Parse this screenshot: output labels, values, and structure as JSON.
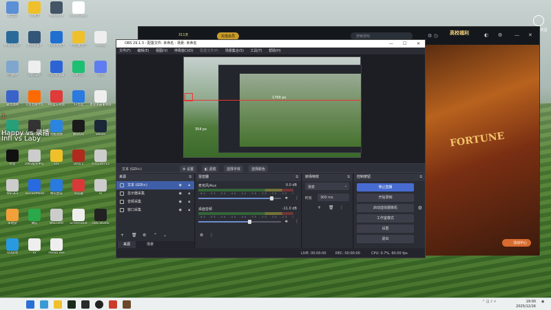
{
  "desktop": {
    "icons": [
      {
        "label": "此电脑",
        "color": "#5b8fd6"
      },
      {
        "label": "YY语音",
        "color": "#f0c02a"
      },
      {
        "label": "WeGame",
        "color": "#445566"
      },
      {
        "label": "SteamDeck",
        "color": "#ffffff"
      },
      {
        "label": "War3_1.27",
        "color": "#2a6a9a"
      },
      {
        "label": "星际争霸II",
        "color": "#335577"
      },
      {
        "label": "YY游戏大厅",
        "color": "#1f6fd1"
      },
      {
        "label": "YY直播大厅",
        "color": "#f0c02a"
      },
      {
        "label": "config",
        "color": "#eeeeee"
      },
      {
        "label": "回收站",
        "color": "#7fa6cc"
      },
      {
        "label": "OBS操作",
        "color": "#eeeeee"
      },
      {
        "label": "迅游加速器",
        "color": "#2c64d6"
      },
      {
        "label": "汽水音乐",
        "color": "#1dbf73"
      },
      {
        "label": "夸克",
        "color": "#5f7df0"
      },
      {
        "label": "最佳战网",
        "color": "#3a63c9"
      },
      {
        "label": "斗鱼直播伴侣",
        "color": "#ff6a00"
      },
      {
        "label": "KK官方对战",
        "color": "#e03a3a"
      },
      {
        "label": "52百度",
        "color": "#2a7ae0"
      },
      {
        "label": "星际争霸重制版",
        "color": "#eeeeee"
      },
      {
        "label": "Microsoft Edge",
        "color": "#27a07a"
      },
      {
        "label": "Glorious Model O",
        "color": "#333333"
      },
      {
        "label": "优酷视频",
        "color": "#2a84e0"
      },
      {
        "label": "腾讯QQ",
        "color": "#1b1b1b"
      },
      {
        "label": "Steam",
        "color": "#1b2838"
      },
      {
        "label": "抖音",
        "color": "#111111"
      },
      {
        "label": "DWS服务中心",
        "color": "#cccccc"
      },
      {
        "label": "sd1",
        "color": "#f0c02a"
      },
      {
        "label": "Dota 2",
        "color": "#b02a1e"
      },
      {
        "label": "435230715",
        "color": "#cccccc"
      },
      {
        "label": "War3Ex",
        "color": "#cccccc"
      },
      {
        "label": "TencentMeet",
        "color": "#2a6ae0"
      },
      {
        "label": "腾讯会议",
        "color": "#2a7ae0"
      },
      {
        "label": "浏览器",
        "color": "#d83a3a"
      },
      {
        "label": "ss",
        "color": "#cccccc"
      },
      {
        "label": "米哈游",
        "color": "#f2a03a"
      },
      {
        "label": "微信",
        "color": "#2aa84a"
      },
      {
        "label": "WSClient",
        "color": "#cccccc"
      },
      {
        "label": "ScreenShot",
        "color": "#eeeeee"
      },
      {
        "label": "OBS Studio",
        "color": "#222222"
      },
      {
        "label": "QQ游戏",
        "color": "#2a9ae0"
      },
      {
        "label": "xx",
        "color": "#eeeeee"
      },
      {
        "label": "steam.exe",
        "color": "#eeeeee"
      }
    ],
    "overlay_line1": "Happy vs 录播",
    "overlay_line2": "Infi vs Laby",
    "overlay_red": "1"
  },
  "game": {
    "coins": "311天",
    "vip_label": "充值会员",
    "search_placeholder": "搜索游戏",
    "banner": "高校福利",
    "art_title": "FORTUNE",
    "live_button": "活动中心",
    "right_widget": "飞鸟聊天回复"
  },
  "obs": {
    "title": "OBS 29.1.3 - 配置文件: 未命名 - 场景: 未命名",
    "menu": [
      "文件(F)",
      "编辑(E)",
      "视图(V)",
      "停靠窗口(D)",
      "配置文件(P)",
      "场景集合(S)",
      "工具(T)",
      "帮助(H)"
    ],
    "preview_px_h": "1769 px",
    "preview_px_v": "354 px",
    "source_toolbar": {
      "source_name": "文本 (GDI+)",
      "settings": "设置",
      "filters": "滤镜",
      "select_font": "选择字体",
      "select_color": "选择颜色"
    },
    "sources": {
      "title": "来源",
      "items": [
        "文本 (GDI+)",
        "显示器采集",
        "音频采集",
        "窗口采集"
      ]
    },
    "tabs": [
      "来源",
      "场景"
    ],
    "mixer": {
      "title": "混音器",
      "channels": [
        {
          "name": "麦克风/Aux",
          "db": "0.0 dB",
          "level": 0.88
        },
        {
          "name": "桌面音频",
          "db": "-11.0 dB",
          "level": 0.62
        }
      ],
      "ticks": "-60 -55 -50 -45 -40 -35 -30 -25 -20 -15 -10 -5 0"
    },
    "transitions": {
      "title": "转场特效",
      "selected": "渐变",
      "duration_label": "时长",
      "duration_value": "300 ms"
    },
    "controls": {
      "title": "控制按钮",
      "buttons": [
        "停止直播",
        "开始录制",
        "启动虚拟摄像机",
        "工作室模式",
        "设置",
        "退出"
      ]
    },
    "status": {
      "live": "LIVE: 00:00:00",
      "rec": "REC: 00:00:00",
      "cpu": "CPU: 0.7%, 60.00 fps"
    }
  },
  "taskbar": {
    "time": "19:00",
    "date": "2025/12/16"
  }
}
